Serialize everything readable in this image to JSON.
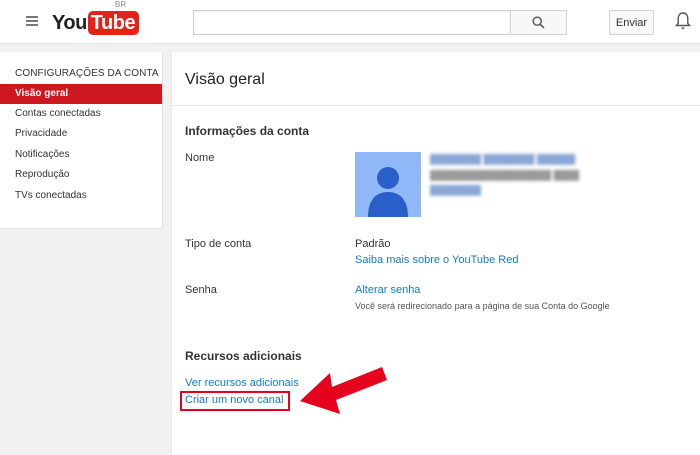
{
  "header": {
    "logo_you": "You",
    "logo_tube": "Tube",
    "region": "BR",
    "search_placeholder": "",
    "upload_label": "Enviar"
  },
  "sidebar": {
    "heading": "CONFIGURAÇÕES DA CONTA",
    "items": [
      {
        "label": "Visão geral",
        "active": true
      },
      {
        "label": "Contas conectadas",
        "active": false
      },
      {
        "label": "Privacidade",
        "active": false
      },
      {
        "label": "Notificações",
        "active": false
      },
      {
        "label": "Reprodução",
        "active": false
      },
      {
        "label": "TVs conectadas",
        "active": false
      }
    ]
  },
  "main": {
    "title": "Visão geral",
    "account_section": "Informações da conta",
    "name_label": "Nome",
    "account_type_label": "Tipo de conta",
    "account_type_value": "Padrão",
    "red_link": "Saiba mais sobre o YouTube Red",
    "password_label": "Senha",
    "change_password_link": "Alterar senha",
    "redirect_hint": "Você será redirecionado para a página de sua Conta do Google",
    "additional_section": "Recursos adicionais",
    "view_features_link": "Ver recursos adicionais",
    "create_channel_link": "Criar um novo canal"
  },
  "colors": {
    "brand_red": "#cc181e",
    "link_blue": "#167ac6",
    "annotation_red": "#e6001e"
  }
}
